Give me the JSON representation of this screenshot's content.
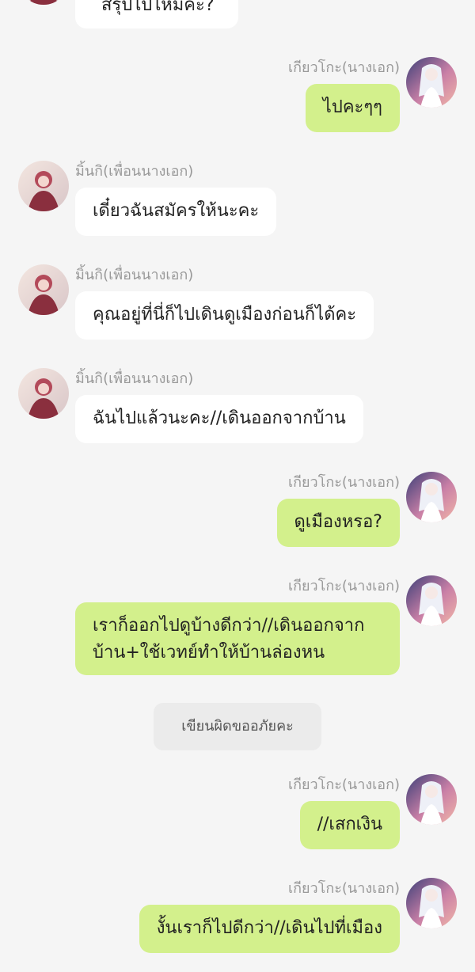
{
  "chat": {
    "partial_top_message": "สรุปไปไหมคะ?",
    "messages": [
      {
        "side": "right",
        "name": "เกียวโกะ(นางเอก)",
        "lines": [
          "ไปคะๆๆ"
        ]
      },
      {
        "side": "left",
        "name": "มิ้นกิ(เพื่อนนางเอก)",
        "lines": [
          "เดี๋ยวฉันสมัครให้นะคะ"
        ]
      },
      {
        "side": "left",
        "name": "มิ้นกิ(เพื่อนนางเอก)",
        "lines": [
          "คุณอยู่ที่นี่ก็ไปเดินดูเมืองก่อนก็ได้คะ"
        ]
      },
      {
        "side": "left",
        "name": "มิ้นกิ(เพื่อนนางเอก)",
        "lines": [
          "ฉันไปแล้วนะคะ//เดินออกจากบ้าน"
        ]
      },
      {
        "side": "right",
        "name": "เกียวโกะ(นางเอก)",
        "lines": [
          "ดูเมืองหรอ?"
        ]
      },
      {
        "side": "right",
        "name": "เกียวโกะ(นางเอก)",
        "lines": [
          "เราก็ออกไปดูบ้างดีกว่า//เดินออกจาก",
          "บ้าน+ใช้เวทย์ทำให้บ้านล่องหน"
        ]
      },
      {
        "side": "right",
        "name": "เกียวโกะ(นางเอก)",
        "lines": [
          "//เสกเงิน"
        ]
      },
      {
        "side": "right",
        "name": "เกียวโกะ(นางเอก)",
        "lines": [
          "งั้นเราก็ไปดีกว่า//เดินไปที่เมือง"
        ]
      }
    ],
    "notice": "เขียนผิดขออภัยคะ"
  },
  "colors": {
    "background": "#f5f5f5",
    "left_bubble": "#ffffff",
    "right_bubble": "#d3f08c",
    "name_text": "#999999",
    "notice_bg": "#ebebeb"
  },
  "icons": {
    "left_avatar": "pink-haired-anime-girl-avatar",
    "right_avatar": "white-haired-anime-girl-avatar"
  }
}
